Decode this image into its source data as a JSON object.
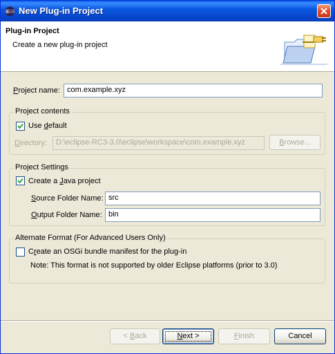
{
  "window": {
    "title": "New Plug-in Project"
  },
  "header": {
    "title": "Plug-in Project",
    "description": "Create a new plug-in project"
  },
  "project_name": {
    "label_pre": "",
    "label_u": "P",
    "label_post": "roject name:",
    "value": "com.example.xyz"
  },
  "contents": {
    "title": "Project contents",
    "use_default": {
      "pre": "Use ",
      "u": "d",
      "post": "efault",
      "checked": true
    },
    "directory": {
      "pre": "",
      "u": "D",
      "post": "irectory:",
      "value": "D:\\eclipse-RC3-3.0\\eclipse\\workspace\\com.example.xyz"
    },
    "browse": {
      "pre": "",
      "u": "B",
      "post": "rowse..."
    }
  },
  "settings": {
    "title": "Project Settings",
    "create_java": {
      "pre": "Create a ",
      "u": "J",
      "post": "ava project",
      "checked": true
    },
    "source": {
      "pre": "",
      "u": "S",
      "post": "ource Folder Name:",
      "value": "src"
    },
    "output": {
      "pre": "",
      "u": "O",
      "post": "utput Folder Name:",
      "value": "bin"
    }
  },
  "alternate": {
    "title": "Alternate Format (For Advanced Users Only)",
    "osgi": {
      "pre": "C",
      "u": "r",
      "post": "eate an OSGi bundle manifest for the plug-in",
      "checked": false
    },
    "note": "Note: This format is not supported by older Eclipse platforms (prior to 3.0)"
  },
  "buttons": {
    "back": {
      "pre": "< ",
      "u": "B",
      "post": "ack"
    },
    "next": {
      "pre": "",
      "u": "N",
      "post": "ext >"
    },
    "finish": {
      "pre": "",
      "u": "F",
      "post": "inish"
    },
    "cancel": "Cancel"
  }
}
